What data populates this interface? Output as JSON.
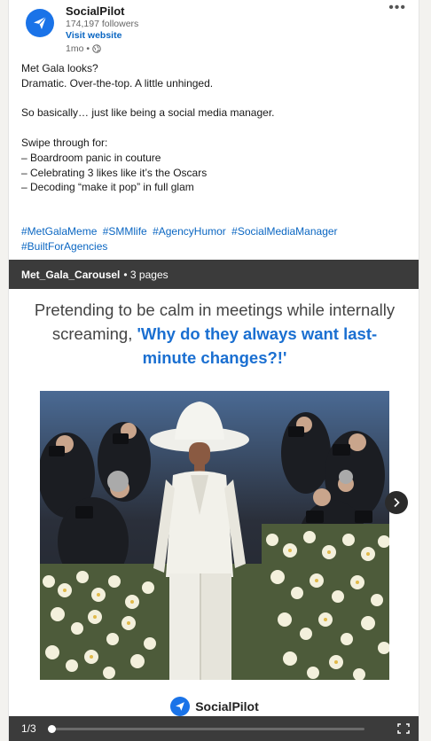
{
  "author": {
    "name": "SocialPilot",
    "followers": "174,197 followers",
    "visit": "Visit website",
    "time": "1mo •"
  },
  "more_label": "•••",
  "post": {
    "paragraphs": [
      "Met Gala looks?\nDramatic. Over-the-top. A little unhinged.",
      "So basically… just like being a social media manager.",
      "Swipe through for:\n– Boardroom panic in couture\n– Celebrating 3 likes like it’s the Oscars\n– Decoding “make it pop” in full glam"
    ],
    "hashtags": [
      "#MetGalaMeme",
      "#SMMlife",
      "#AgencyHumor",
      "#SocialMediaManager",
      "#BuiltForAgencies"
    ]
  },
  "document": {
    "filename": "Met_Gala_Carousel",
    "pages_label": "• 3 pages"
  },
  "slide": {
    "heading_plain": "Pretending to be calm in meetings while internally screaming, ",
    "heading_highlight": "'Why do they always want last-minute changes?!'",
    "brand": "SocialPilot"
  },
  "footer": {
    "page_indicator": "1/3",
    "progress": 0.0
  },
  "colors": {
    "brand_blue": "#1a73e8",
    "link_blue": "#0a66c2",
    "highlight_blue": "#1a6fd1",
    "bar_dark": "#3b3b3b"
  },
  "icons": [
    "send-logo-icon",
    "globe-icon",
    "chevron-right-icon",
    "fullscreen-icon"
  ]
}
